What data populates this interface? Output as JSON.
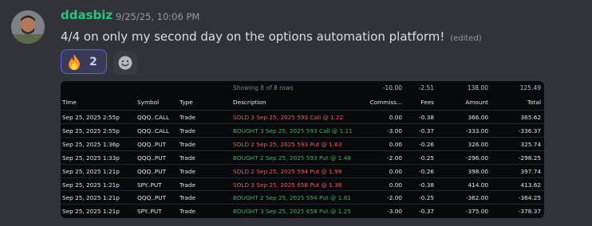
{
  "message": {
    "username": "ddasbiz",
    "timestamp": "9/25/25, 10:06 PM",
    "text": "4/4 on only my second day on the options automation platform!",
    "edited": "(edited)",
    "reaction": {
      "emoji": "fire-icon",
      "count": "2"
    },
    "add_reaction_icon": "smiley-icon"
  },
  "table": {
    "showing": "Showing 8 of 8 rows",
    "totals": {
      "commission": "-10.00",
      "fees": "-2.51",
      "amount": "138.00",
      "total": "125.49"
    },
    "columns": [
      "Time",
      "Symbol",
      "Type",
      "Description",
      "Commiss...",
      "Fees",
      "Amount",
      "Total"
    ],
    "rows": [
      {
        "time": "Sep 25, 2025 2:55p",
        "symbol": "QQQ..CALL",
        "type": "Trade",
        "desc": "SOLD 3 Sep 25, 2025 593 Call @ 1.22",
        "action": "sold",
        "commission": "0.00",
        "fees": "-0.38",
        "amount": "366.00",
        "total": "365.62"
      },
      {
        "time": "Sep 25, 2025 2:55p",
        "symbol": "QQQ..CALL",
        "type": "Trade",
        "desc": "BOUGHT 3 Sep 25, 2025 593 Call @ 1.11",
        "action": "bought",
        "commission": "-3.00",
        "fees": "-0.37",
        "amount": "-333.00",
        "total": "-336.37"
      },
      {
        "time": "Sep 25, 2025 1:36p",
        "symbol": "QQQ..PUT",
        "type": "Trade",
        "desc": "SOLD 2 Sep 25, 2025 593 Put @ 1.63",
        "action": "sold",
        "commission": "0.00",
        "fees": "-0.26",
        "amount": "326.00",
        "total": "325.74"
      },
      {
        "time": "Sep 25, 2025 1:33p",
        "symbol": "QQQ..PUT",
        "type": "Trade",
        "desc": "BOUGHT 2 Sep 25, 2025 593 Put @ 1.48",
        "action": "bought",
        "commission": "-2.00",
        "fees": "-0.25",
        "amount": "-296.00",
        "total": "-298.25"
      },
      {
        "time": "Sep 25, 2025 1:21p",
        "symbol": "QQQ..PUT",
        "type": "Trade",
        "desc": "SOLD 2 Sep 25, 2025 594 Put @ 1.99",
        "action": "sold",
        "commission": "0.00",
        "fees": "-0.26",
        "amount": "398.00",
        "total": "397.74"
      },
      {
        "time": "Sep 25, 2025 1:21p",
        "symbol": "SPY..PUT",
        "type": "Trade",
        "desc": "SOLD 3 Sep 25, 2025 658 Put @ 1.38",
        "action": "sold",
        "commission": "0.00",
        "fees": "-0.38",
        "amount": "414.00",
        "total": "413.62"
      },
      {
        "time": "Sep 25, 2025 1:21p",
        "symbol": "QQQ..PUT",
        "type": "Trade",
        "desc": "BOUGHT 2 Sep 25, 2025 594 Put @ 1.81",
        "action": "bought",
        "commission": "-2.00",
        "fees": "-0.25",
        "amount": "-362.00",
        "total": "-364.25"
      },
      {
        "time": "Sep 25, 2025 1:21p",
        "symbol": "SPY..PUT",
        "type": "Trade",
        "desc": "BOUGHT 3 Sep 25, 2025 658 Put @ 1.25",
        "action": "bought",
        "commission": "-3.00",
        "fees": "-0.37",
        "amount": "-375.00",
        "total": "-378.37"
      }
    ]
  },
  "colors": {
    "username": "#2ec27e",
    "sold": "#ef5a5a",
    "bought": "#3fae5f",
    "reaction_border": "#5865f2"
  }
}
